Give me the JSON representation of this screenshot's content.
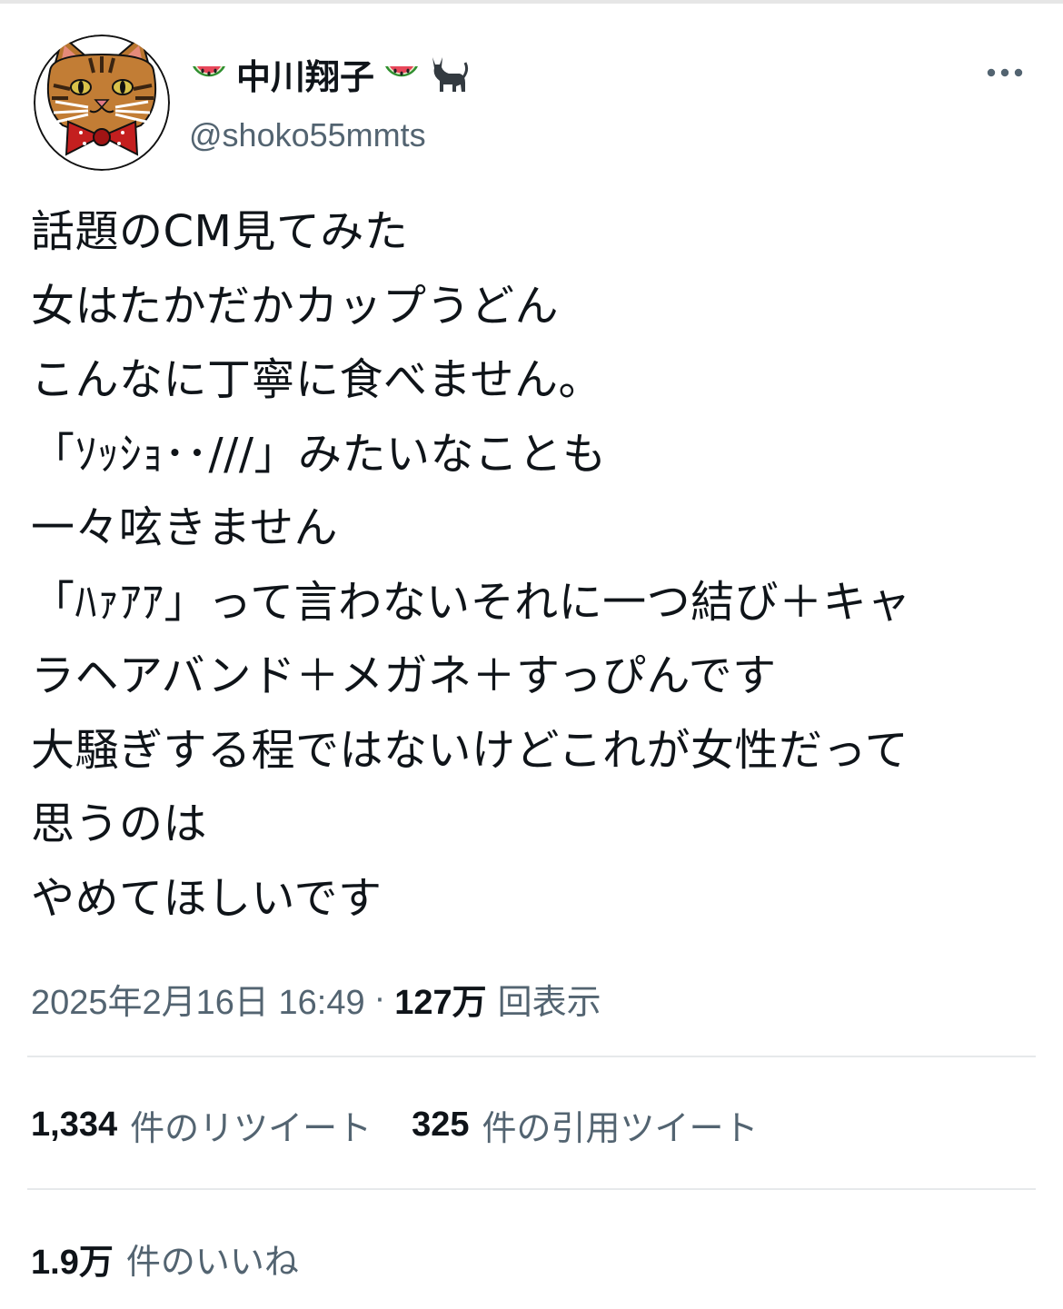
{
  "author": {
    "display_name": "中川翔子",
    "handle": "@shoko55mmts",
    "name_icons": [
      "watermelon-icon",
      "watermelon-icon",
      "black-cat-icon"
    ],
    "avatar": "cat-illustration-avatar"
  },
  "tweet": {
    "lines": [
      "話題のCM見てみた",
      "女はたかだかカップうどん",
      "こんなに丁寧に食べません。",
      "「ｿｯｼｮ･･///」みたいなことも",
      "一々呟きません",
      "「ﾊｧｱｱ」って言わないそれに一つ結び＋キャ",
      "ラヘアバンド＋メガネ＋すっぴんです",
      "大騒ぎする程ではないけどこれが女性だって",
      "思うのは",
      "やめてほしいです"
    ]
  },
  "meta": {
    "timestamp": "2025年2月16日 16:49",
    "separator": "·",
    "views_count": "127万",
    "views_label": "回表示"
  },
  "stats": {
    "retweets_count": "1,334",
    "retweets_label": "件のリツイート",
    "quotes_count": "325",
    "quotes_label": "件の引用ツイート",
    "likes_count": "1.9万",
    "likes_label": "件のいいね"
  },
  "colors": {
    "text_primary": "#0f1419",
    "text_secondary": "#536471",
    "divider": "#e6e9eb"
  }
}
